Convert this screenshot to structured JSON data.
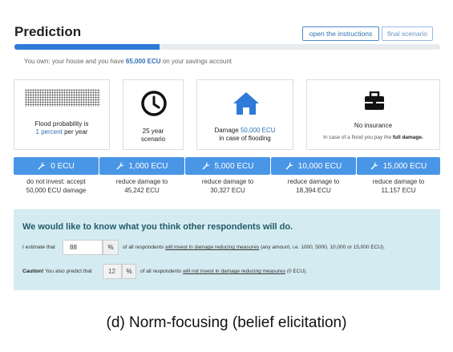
{
  "header": {
    "title": "Prediction",
    "instructions_label": "open the instructions",
    "final_label": "final scenario",
    "progress_fraction": 0.34
  },
  "savings": {
    "prefix": "You own: your house and you have",
    "amount": "65,000 ECU",
    "suffix": "on your savings account"
  },
  "cards": {
    "flood": {
      "line1": "Flood probability is",
      "value": "1 percent",
      "suffix": "per year"
    },
    "years": {
      "value": "25 year",
      "label": "scenario"
    },
    "damage": {
      "prefix": "Damage",
      "value": "50,000 ECU",
      "label": "in case of flooding"
    },
    "insurance": {
      "title": "No insurance",
      "desc_prefix": "In case of a flood you pay the",
      "desc_bold": "full damage."
    }
  },
  "investments": [
    {
      "label": "0 ECU",
      "result_line1": "do not invest: accept",
      "result_line2": "50,000 ECU damage"
    },
    {
      "label": "1,000 ECU",
      "result_line1": "reduce damage to",
      "result_line2": "45,242 ECU"
    },
    {
      "label": "5,000 ECU",
      "result_line1": "reduce damage to",
      "result_line2": "30,327 ECU"
    },
    {
      "label": "10,000 ECU",
      "result_line1": "reduce damage to",
      "result_line2": "18,394 ECU"
    },
    {
      "label": "15,000 ECU",
      "result_line1": "reduce damage to",
      "result_line2": "11,157 ECU"
    }
  ],
  "elicitation": {
    "heading": "We would like to know what you think other respondents will do.",
    "q1_prefix": "I estimate that",
    "q1_value": "88",
    "pct_symbol": "%",
    "q1_mid": "of all respondents",
    "q1_link": "will invest in damage reducing measures",
    "q1_suffix": "(any amount, i.e. 1000, 5000, 10,000 or 15,000 ECU).",
    "caution_bold": "Caution!",
    "caution_text": "You also predict that",
    "q2_value": "12",
    "q2_mid": "of all respondents",
    "q2_link": "will not invest in damage reducing measures",
    "q2_suffix": "(0 ECU)."
  },
  "caption": "(d) Norm-focusing (belief elicitation)",
  "colors": {
    "accent": "#2f7ad8",
    "button": "#4a96e6",
    "panel": "#d4ecf1"
  }
}
